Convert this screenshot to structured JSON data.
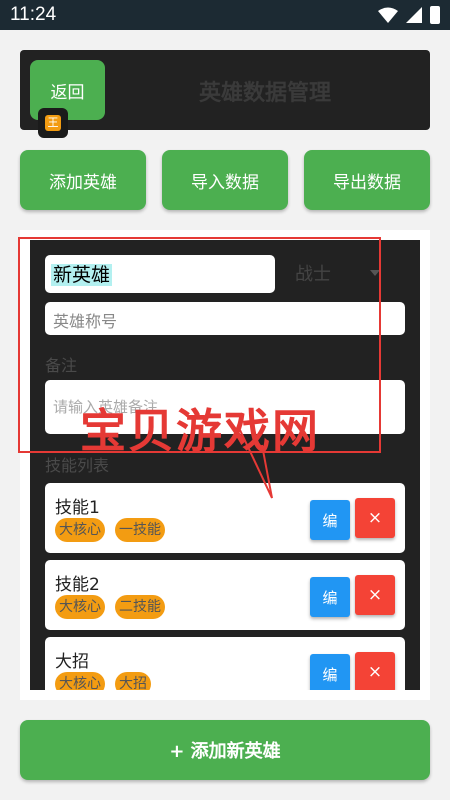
{
  "status": {
    "time": "11:24"
  },
  "header": {
    "back_label": "返回",
    "title": "英雄数据管理",
    "app_icon_char": "王"
  },
  "actions": {
    "add": "添加英雄",
    "import": "导入数据",
    "export": "导出数据"
  },
  "form": {
    "name_value": "新英雄",
    "role_value": "战士",
    "title_placeholder": "英雄称号",
    "note_label": "备注",
    "note_placeholder": "请输入英雄备注",
    "skills_label": "技能列表"
  },
  "skills": [
    {
      "name": "技能1",
      "tags": [
        "大核心",
        "一技能"
      ],
      "edit": "编",
      "delete": "×"
    },
    {
      "name": "技能2",
      "tags": [
        "大核心",
        "二技能"
      ],
      "edit": "编",
      "delete": "×"
    },
    {
      "name": "大招",
      "tags": [
        "大核心",
        "大招"
      ],
      "edit": "编",
      "delete": "×"
    }
  ],
  "watermark": {
    "text": "宝贝游戏网"
  },
  "footer": {
    "add_new": "+ 添加新英雄"
  },
  "colors": {
    "accent_green": "#4caf50",
    "edit_blue": "#2196f3",
    "delete_red": "#f44336",
    "tag_orange": "#f39c12"
  }
}
